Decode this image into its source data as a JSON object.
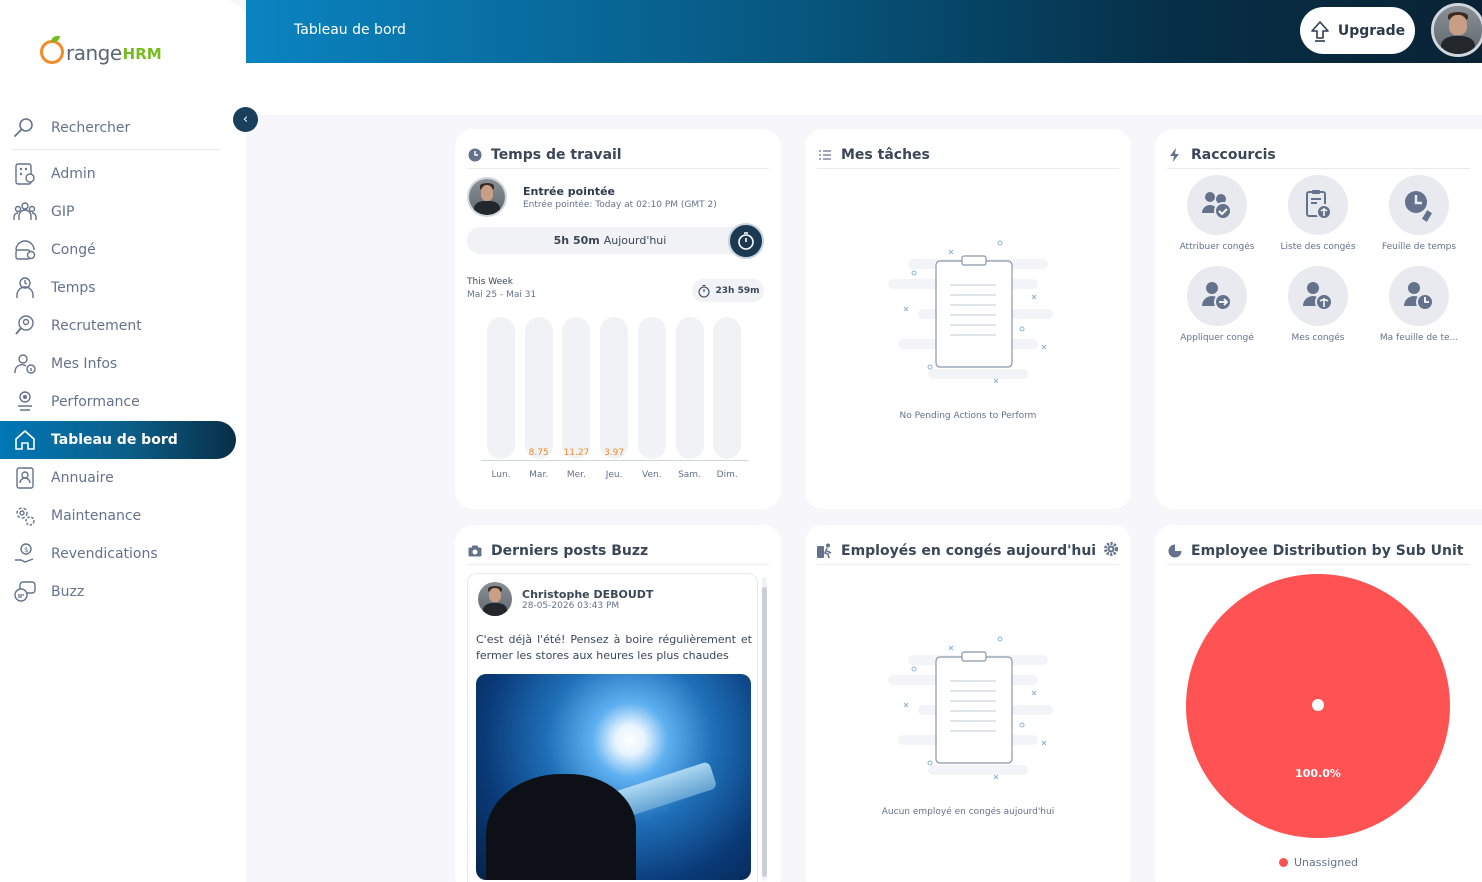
{
  "app": {
    "logo_word": "range",
    "logo_suffix": "HRM",
    "brand_colors": {
      "orange": "#f28c28",
      "green": "#76bc21",
      "nav_active": "#0b5e87"
    }
  },
  "header": {
    "title": "Tableau de bord",
    "upgrade_label": "Upgrade"
  },
  "sidebar": {
    "search_label": "Rechercher",
    "collapse_icon": "chevron-left-icon",
    "items": [
      {
        "label": "Admin",
        "icon": "admin-icon"
      },
      {
        "label": "GIP",
        "icon": "team-icon"
      },
      {
        "label": "Congé",
        "icon": "leave-icon"
      },
      {
        "label": "Temps",
        "icon": "time-icon"
      },
      {
        "label": "Recrutement",
        "icon": "recruitment-icon"
      },
      {
        "label": "Mes Infos",
        "icon": "my-info-icon"
      },
      {
        "label": "Performance",
        "icon": "performance-icon"
      },
      {
        "label": "Tableau de bord",
        "icon": "home-icon",
        "active": true
      },
      {
        "label": "Annuaire",
        "icon": "directory-icon"
      },
      {
        "label": "Maintenance",
        "icon": "maintenance-icon"
      },
      {
        "label": "Revendications",
        "icon": "claim-icon"
      },
      {
        "label": "Buzz",
        "icon": "buzz-icon"
      }
    ]
  },
  "time_at_work": {
    "title": "Temps de travail",
    "status": "Entrée pointée",
    "status_detail": "Entrée pointée: Today at 02:10 PM (GMT 2)",
    "today_hours": "5h 50m",
    "today_label": "Aujourd'hui",
    "week_label": "This Week",
    "week_range": "Mai 25 - Mai 31",
    "week_total": "23h 59m"
  },
  "chart_data": {
    "type": "bar",
    "categories": [
      "Lun.",
      "Mar.",
      "Mer.",
      "Jeu.",
      "Ven.",
      "Sam.",
      "Dim."
    ],
    "values": [
      null,
      8.75,
      11.27,
      3.97,
      null,
      null,
      null
    ],
    "value_labels": [
      "",
      "8.75",
      "11.27",
      "3.97",
      "",
      "",
      ""
    ]
  },
  "my_actions": {
    "title": "Mes tâches",
    "empty_text": "No Pending Actions to Perform"
  },
  "shortcuts": {
    "title": "Raccourcis",
    "items": [
      {
        "label": "Attribuer congés",
        "icon": "assign-leave-icon"
      },
      {
        "label": "Liste des congés",
        "icon": "leave-list-icon"
      },
      {
        "label": "Feuille de temps",
        "icon": "timesheet-icon"
      },
      {
        "label": "Appliquer congé",
        "icon": "apply-leave-icon"
      },
      {
        "label": "Mes congés",
        "icon": "my-leave-icon"
      },
      {
        "label": "Ma feuille de te...",
        "icon": "my-timesheet-icon"
      }
    ]
  },
  "buzz": {
    "title": "Derniers posts Buzz",
    "author": "Christophe DEBOUDT",
    "date": "28-05-2026 03:43 PM",
    "text": "C'est déjà l'été! Pensez à boire régulièrement et fermer les stores aux heures les plus chaudes"
  },
  "on_leave": {
    "title": "Employés en congés aujourd'hui",
    "empty_text": "Aucun employé en congés aujourd'hui"
  },
  "distribution": {
    "title": "Employee Distribution by Sub Unit",
    "slices": [
      {
        "label": "Unassigned",
        "value": 100.0,
        "display": "100.0%",
        "color": "#ff5252"
      }
    ]
  }
}
